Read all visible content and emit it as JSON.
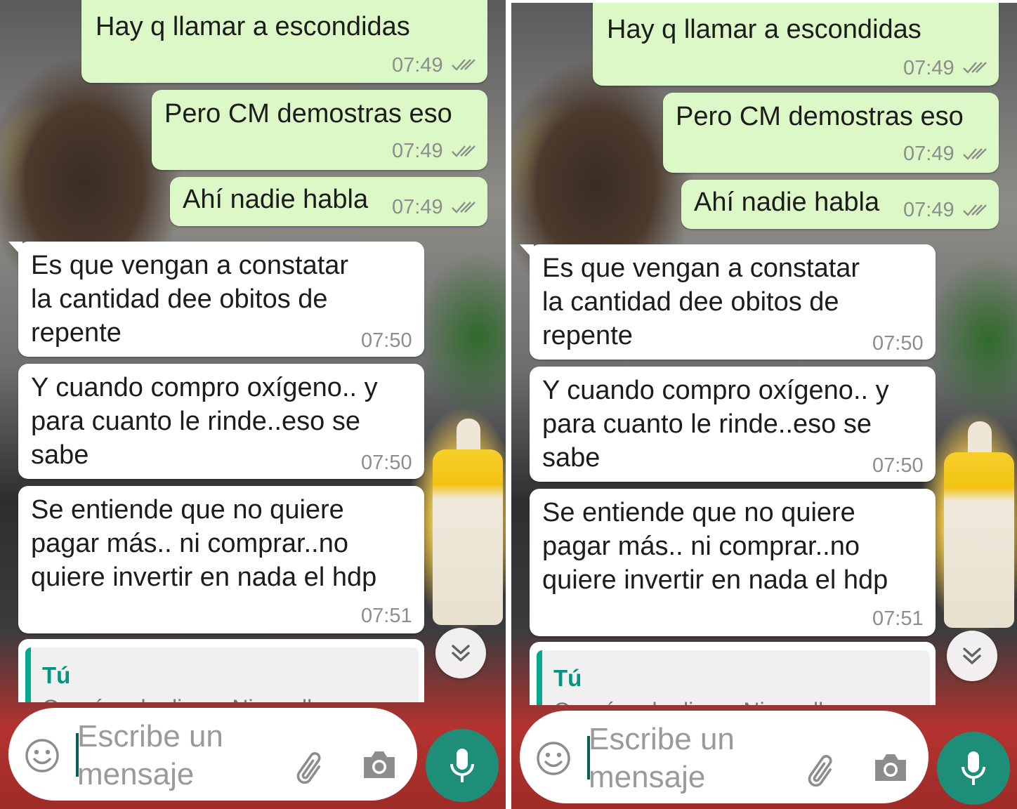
{
  "colors": {
    "outgoing_bubble": "#dcf8c6",
    "incoming_bubble": "#ffffff",
    "accent": "#069482",
    "mic_button": "#1f8e78",
    "timestamp": "#8a8f8b"
  },
  "messages": [
    {
      "direction": "outgoing",
      "text": "Hay q llamar a escondidas",
      "time": "07:49",
      "status": "double-check-icon"
    },
    {
      "direction": "outgoing",
      "text": "Pero CM demostras eso",
      "time": "07:49",
      "status": "double-check-icon"
    },
    {
      "direction": "outgoing",
      "text": "Ahí nadie habla",
      "time": "07:49",
      "status": "double-check-icon"
    },
    {
      "direction": "incoming",
      "text": "Es que vengan a constatar\nla cantidad dee obitos de\nrepente",
      "time": "07:50"
    },
    {
      "direction": "incoming",
      "text": "Y cuando compro oxígeno.. y\npara cuanto le rinde..eso se\nsabe",
      "time": "07:50"
    },
    {
      "direction": "incoming",
      "text": "Se entiende que no quiere\npagar más.. ni comprar..no\nquiere invertir en nada el hdp",
      "time": "07:51"
    }
  ],
  "reply_preview": {
    "author": "Tú",
    "text": "Querés q le diga a Nico q llame"
  },
  "composer": {
    "placeholder": "Escribe un\nmensaje",
    "emoji_icon": "smiley-icon",
    "attach_icon": "paperclip-icon",
    "camera_icon": "camera-icon",
    "mic_icon": "microphone-icon",
    "scroll_icon": "double-chevron-down-icon"
  }
}
